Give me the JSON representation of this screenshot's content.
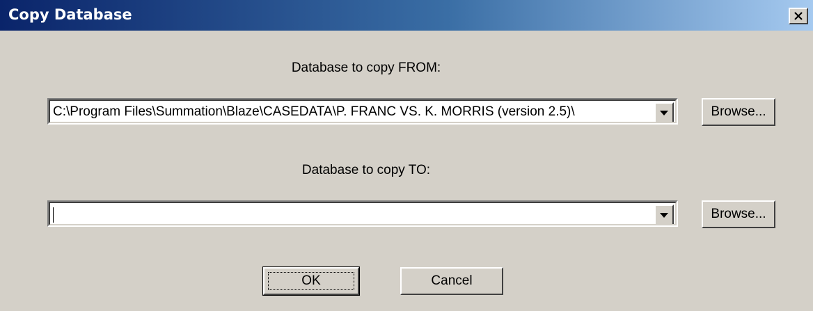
{
  "window": {
    "title": "Copy Database",
    "close_glyph": "✕"
  },
  "from": {
    "label": "Database to copy FROM:",
    "value": "C:\\Program Files\\Summation\\Blaze\\CASEDATA\\P. FRANC VS. K. MORRIS (version 2.5)\\",
    "browse_label": "Browse..."
  },
  "to": {
    "label": "Database to copy TO:",
    "value": "",
    "browse_label": "Browse..."
  },
  "buttons": {
    "ok_label": "OK",
    "cancel_label": "Cancel"
  }
}
